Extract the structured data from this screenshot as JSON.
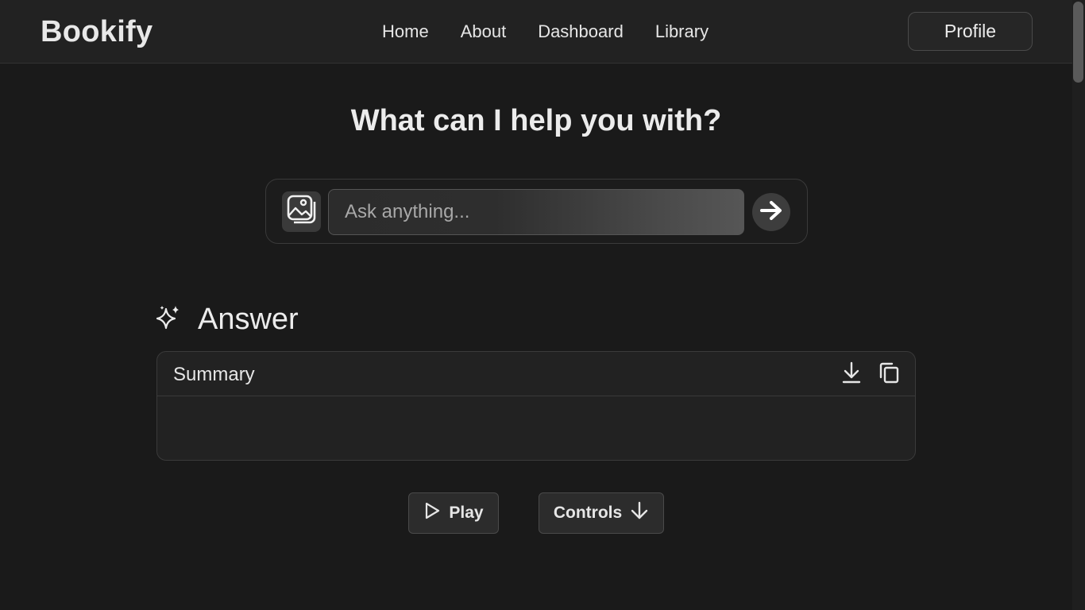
{
  "header": {
    "brand": "Bookify",
    "nav": [
      {
        "label": "Home"
      },
      {
        "label": "About"
      },
      {
        "label": "Dashboard"
      },
      {
        "label": "Library"
      }
    ],
    "profile_label": "Profile"
  },
  "main": {
    "headline": "What can I help you with?",
    "search": {
      "value": "",
      "placeholder": "Ask anything...",
      "image_icon": "image-upload-icon",
      "send_icon": "arrow-right-icon"
    },
    "answer": {
      "icon": "sparkles-icon",
      "title": "Answer",
      "summary_title": "Summary",
      "summary_text": "",
      "download_icon": "download-icon",
      "copy_icon": "copy-icon"
    },
    "controls": {
      "play_label": "Play",
      "controls_label": "Controls"
    }
  },
  "colors": {
    "background": "#1a1a1a",
    "header_bg": "#222222",
    "text": "#e6e6e6"
  }
}
